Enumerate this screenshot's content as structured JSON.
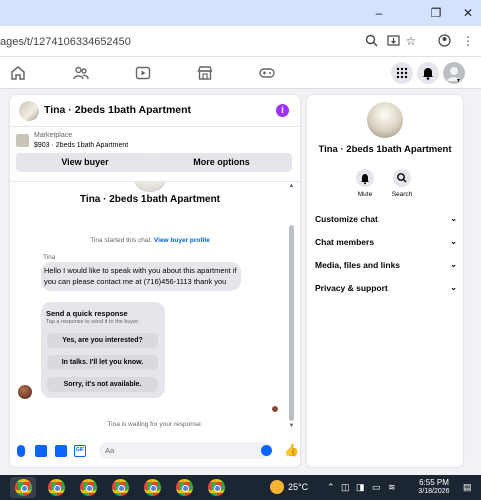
{
  "browser": {
    "url": "ages/t/1274106334652450",
    "window_controls": {
      "minimize": "–",
      "restore": "❐",
      "close": "✕"
    }
  },
  "chat": {
    "title": "Tina · 2beds 1bath Apartment",
    "listing": {
      "tag": "Marketplace",
      "price_line": "$903 · 2beds 1bath Apartment"
    },
    "buttons": {
      "view_buyer": "View buyer",
      "more_options": "More options"
    },
    "thread": {
      "title": "Tina · 2beds 1bath Apartment",
      "started_text": "Tina started this chat.",
      "started_link": "View buyer profile",
      "sender_name": "Tina",
      "message": "Hello I would like to speak with you about this apartment if you can please contact me at (716)456-1113 thank you",
      "quick_response": {
        "title": "Send a quick response",
        "subtitle": "Tap a response to send it to the buyer.",
        "options": [
          "Yes, are you interested?",
          "In talks. I'll let you know.",
          "Sorry, it's not available."
        ]
      },
      "waiting_text": "Tina is waiting for your response."
    },
    "composer": {
      "placeholder": "Aa"
    }
  },
  "info_panel": {
    "title": "Tina · 2beds 1bath Apartment",
    "actions": [
      {
        "label": "Mute",
        "icon": "bell-icon"
      },
      {
        "label": "Search",
        "icon": "search-icon"
      }
    ],
    "sections": [
      "Customize chat",
      "Chat members",
      "Media, files and links",
      "Privacy & support"
    ]
  },
  "taskbar": {
    "temperature": "25°C",
    "time": "6:55 PM",
    "date": "3/18/2026"
  },
  "colors": {
    "accent": "#0866ff",
    "info_badge": "#a033ff",
    "taskbar": "#1c2633"
  }
}
